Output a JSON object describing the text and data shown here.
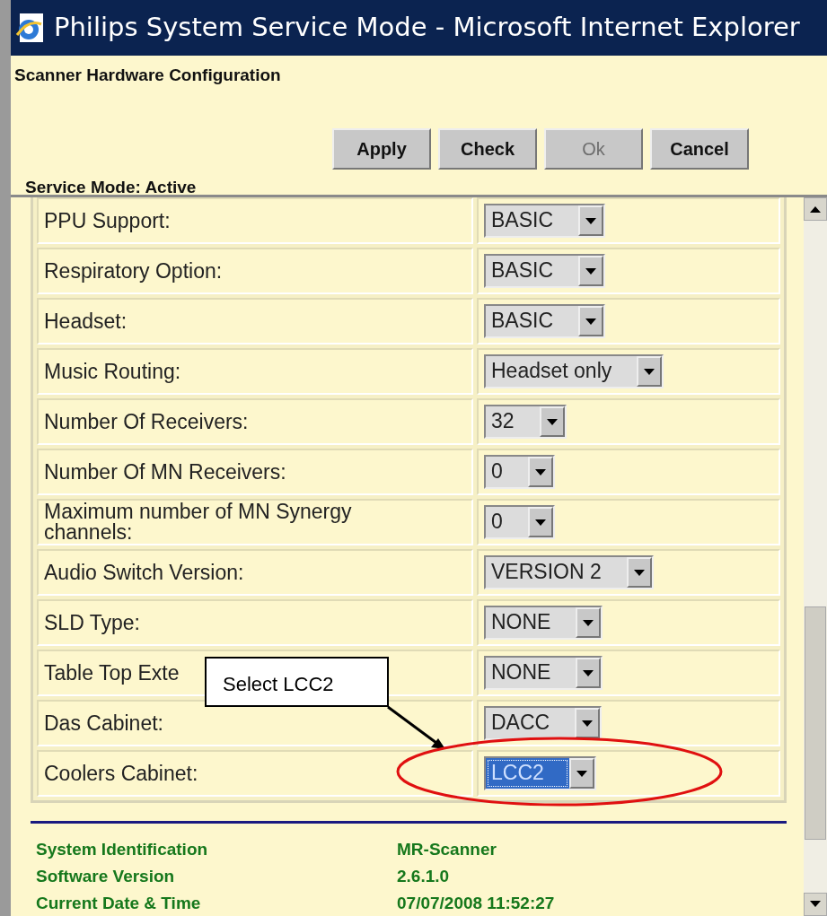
{
  "window": {
    "title": "Philips System Service Mode - Microsoft Internet Explorer"
  },
  "header": {
    "title": "Scanner Hardware Configuration",
    "status": "Service Mode: Active"
  },
  "buttons": [
    {
      "label": "Apply",
      "disabled": false
    },
    {
      "label": "Check",
      "disabled": false
    },
    {
      "label": "Ok",
      "disabled": true
    },
    {
      "label": "Cancel",
      "disabled": false
    }
  ],
  "settings": [
    {
      "label": "PPU Support:",
      "value": "BASIC",
      "selected": false
    },
    {
      "label": "Respiratory Option:",
      "value": "BASIC",
      "selected": false
    },
    {
      "label": "Headset:",
      "value": "BASIC",
      "selected": false
    },
    {
      "label": "Music Routing:",
      "value": "Headset only",
      "selected": false
    },
    {
      "label": "Number Of Receivers:",
      "value": "32",
      "selected": false
    },
    {
      "label": "Number Of MN Receivers:",
      "value": "0",
      "selected": false
    },
    {
      "label": "Maximum number of MN Synergy channels:",
      "value": "0",
      "selected": false
    },
    {
      "label": "Audio Switch Version:",
      "value": "VERSION 2",
      "selected": false
    },
    {
      "label": "SLD Type:",
      "value": "NONE",
      "selected": false
    },
    {
      "label": "Table Top Exte",
      "value": "NONE",
      "selected": false
    },
    {
      "label": "Das Cabinet:",
      "value": "DACC",
      "selected": false
    },
    {
      "label": "Coolers Cabinet:",
      "value": "LCC2",
      "selected": true
    }
  ],
  "footer": [
    {
      "label": "System Identification",
      "value": "MR-Scanner"
    },
    {
      "label": "Software Version",
      "value": "2.6.1.0"
    },
    {
      "label": "Current Date & Time",
      "value": "07/07/2008 11:52:27"
    }
  ],
  "annotation": {
    "text": "Select LCC2"
  }
}
